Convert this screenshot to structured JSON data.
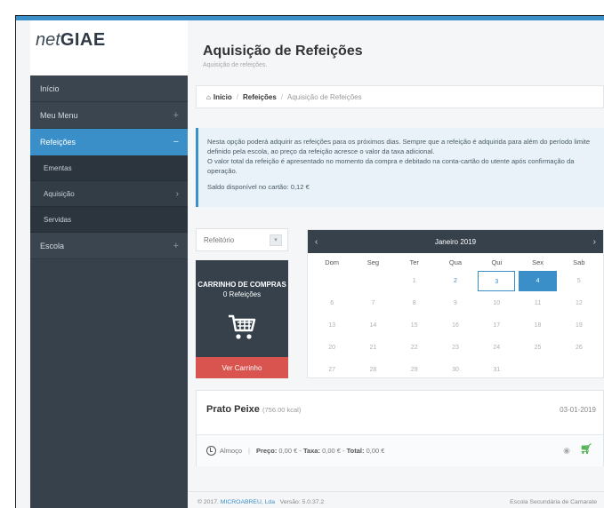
{
  "brand": {
    "net": "net",
    "giae": "GIAE"
  },
  "sidebar": {
    "items": [
      {
        "label": "Início"
      },
      {
        "label": "Meu Menu",
        "icon": "+"
      },
      {
        "label": "Refeições",
        "icon": "−"
      },
      {
        "label": "Escola",
        "icon": "+"
      }
    ],
    "sub": [
      {
        "label": "Ementas"
      },
      {
        "label": "Aquisição",
        "icon": "›"
      },
      {
        "label": "Servidas"
      }
    ]
  },
  "header": {
    "title": "Aquisição de Refeições",
    "subtitle": "Aquisição de refeições."
  },
  "breadcrumb": {
    "home": "Início",
    "sep": "/",
    "section": "Refeições",
    "current": "Aquisição de Refeições"
  },
  "info": {
    "line1": "Nesta opção poderá adquirir as refeições para os próximos dias. Sempre que a refeição é adquirida para além do período limite definido pela escola, ao preço da refeição acresce o valor da taxa adicional.",
    "line2": "O valor total da refeição é apresentado no momento da compra e debitado na conta-cartão do utente após confirmação da operação.",
    "line3": "Saldo disponível no cartão: 0,12 €"
  },
  "select": {
    "value": "Refeitório"
  },
  "cart": {
    "title": "CARRINHO DE COMPRAS",
    "count": "0 Refeições",
    "button": "Ver Carrinho"
  },
  "calendar": {
    "month": "Janeiro 2019",
    "prev": "‹",
    "next": "›",
    "days": [
      "Dom",
      "Seg",
      "Ter",
      "Qua",
      "Qui",
      "Sex",
      "Sab"
    ],
    "cells": [
      "",
      "",
      "1",
      "2",
      "3",
      "4",
      "5",
      "6",
      "7",
      "8",
      "9",
      "10",
      "11",
      "12",
      "13",
      "14",
      "15",
      "16",
      "17",
      "18",
      "19",
      "20",
      "21",
      "22",
      "23",
      "24",
      "25",
      "26",
      "27",
      "28",
      "29",
      "30",
      "31",
      "",
      ""
    ],
    "available": [
      "2"
    ],
    "today": "3",
    "selected": "4"
  },
  "meal": {
    "name": "Prato Peixe",
    "kcal": "(756.00 kcal)",
    "date": "03-01-2019",
    "period": "Almoço",
    "price_label": "Preço:",
    "price": "0,00 €",
    "tax_label": "Taxa:",
    "tax": "0,00 €",
    "total_label": "Total:",
    "total": "0,00 €"
  },
  "footer": {
    "copy": "© 2017.",
    "company": "MICROABREU, Lda",
    "version": "Versão: 5.0.37.2",
    "school": "Escola Secundária de Camarate"
  },
  "colors": {
    "accent": "#3a8fc8",
    "sidebar": "#36414b",
    "danger": "#d9534f",
    "success": "#4cae4c"
  }
}
